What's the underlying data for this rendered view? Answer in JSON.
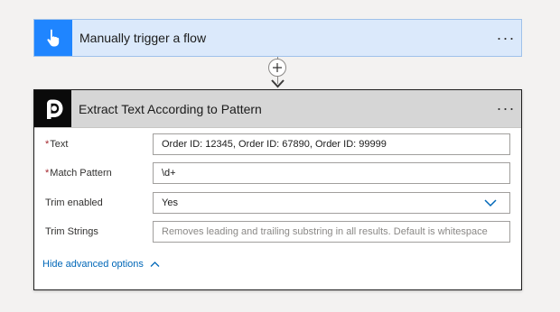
{
  "trigger": {
    "title": "Manually trigger a flow",
    "icon": "hand-touch-icon",
    "menu_label": "···",
    "colors": {
      "icon_bg": "#1f85ff",
      "card_bg": "#dbe9fb"
    }
  },
  "connector": {
    "add_icon": "plus-icon",
    "arrow_icon": "arrow-down-icon"
  },
  "action": {
    "title": "Extract Text According to Pattern",
    "icon": "plumsail-logo-icon",
    "menu_label": "···",
    "fields": [
      {
        "label": "Text",
        "required": "*",
        "value": "Order ID: 12345, Order ID: 67890, Order ID: 99999",
        "placeholder": ""
      },
      {
        "label": "Match Pattern",
        "required": "*",
        "value": "\\d+",
        "placeholder": ""
      },
      {
        "label": "Trim enabled",
        "required": "",
        "value": "Yes",
        "placeholder": ""
      },
      {
        "label": "Trim Strings",
        "required": "",
        "value": "",
        "placeholder": "Removes leading and trailing substring in all results. Default is whitespace"
      }
    ],
    "advanced_link": "Hide advanced options",
    "colors": {
      "required": "#a4262c",
      "link": "#0067b8",
      "header_bg": "#d6d6d6"
    }
  }
}
